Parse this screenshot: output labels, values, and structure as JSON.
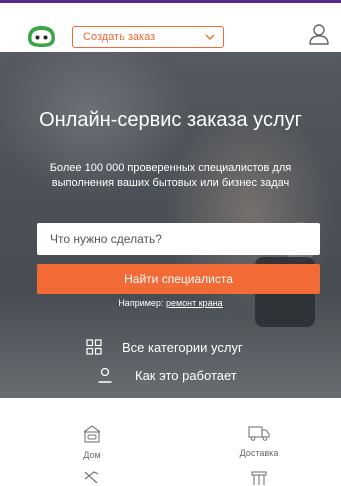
{
  "header": {
    "logo_icon": "smiley-logo-icon",
    "select_value": "Создать заказ",
    "chevron_icon": "chevron-down-icon",
    "profile_icon": "user-icon",
    "brand_color": "#f26a36",
    "logo_color": "#3aa647"
  },
  "hero": {
    "title": "Онлайн-сервис заказа услуг",
    "subtitle": "Более 100 000 проверенных специалистов для выполнения ваших бытовых или бизнес задач",
    "search_placeholder": "Что нужно сделать?",
    "find_button": "Найти специалиста",
    "example_prefix": "Например:",
    "example_link": "ремонт крана",
    "all_categories": "Все категории услуг",
    "how_it_works": "Как это работает"
  },
  "categories": [
    {
      "label": "Дом",
      "icon": "house-icon"
    },
    {
      "label": "Доставка",
      "icon": "truck-icon"
    },
    {
      "label": "",
      "icon": "tools-icon"
    },
    {
      "label": "",
      "icon": "kiosk-icon"
    }
  ]
}
